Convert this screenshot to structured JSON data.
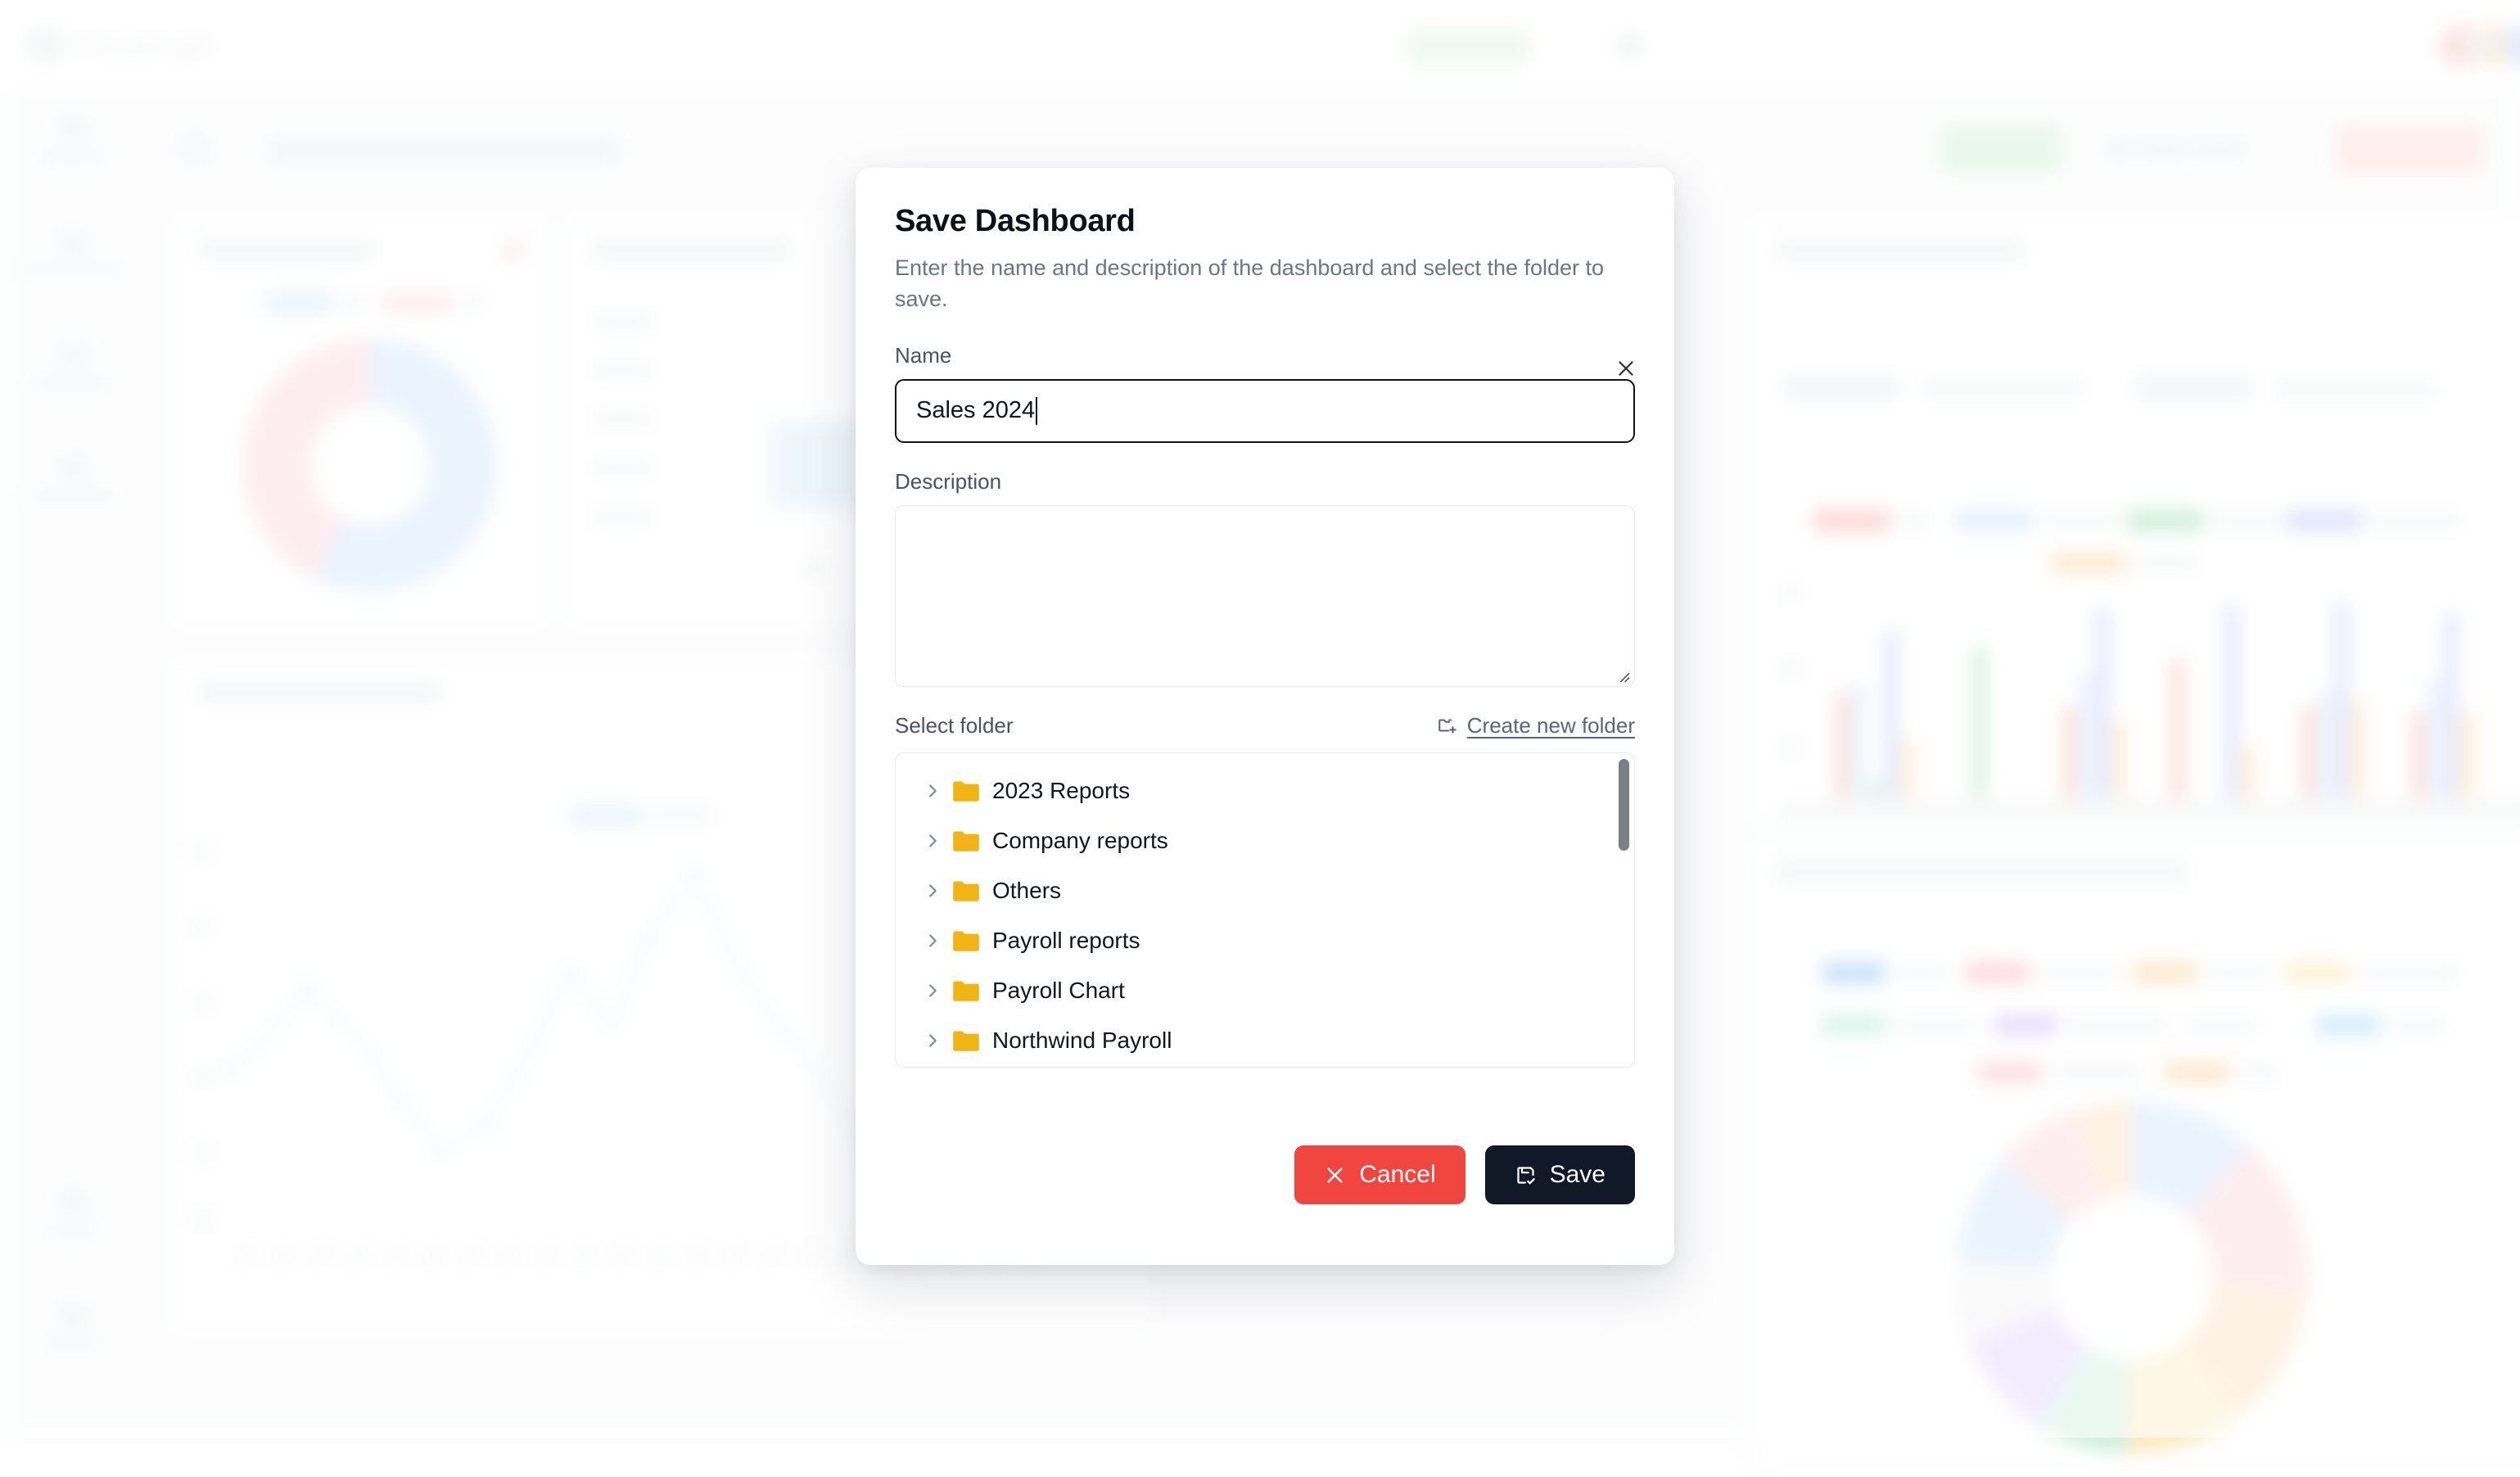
{
  "background": {
    "brand": "Flowtrail",
    "logo_icon": "grid-logo-icon",
    "topbar": {
      "upgrade_button": "",
      "avatar_colors": [
        "#f7b9b4",
        "#f8cda0",
        "#b9cdf5",
        "#f7a8bc",
        "#f6b6c6",
        "#8d9299"
      ],
      "green_button_color": "#d9efdc",
      "red_button_color": "#fcd8d6"
    },
    "sidebar_items": [
      "",
      "",
      "",
      "",
      "",
      ""
    ],
    "cards": [
      {
        "title": "Gender report",
        "type": "donut"
      },
      {
        "title": "Payroll by month",
        "type": "bar"
      },
      {
        "title": "Weekly attendance",
        "type": "grouped-bar"
      },
      {
        "title": "Shares by category",
        "type": "line"
      },
      {
        "title": "Asset Plant Cost Breakdown",
        "type": "donut"
      }
    ],
    "accent_colors": {
      "pink": "#fbd5dd",
      "blue": "#cfe4fa",
      "green": "#c7ecd0",
      "orange": "#fbdcb6",
      "purple": "#ddd8fb",
      "yellow": "#fdebc0"
    }
  },
  "modal": {
    "title": "Save Dashboard",
    "subtitle": "Enter the name and description of the dashboard and select the folder to save.",
    "close_icon": "close-icon",
    "name": {
      "label": "Name",
      "value": "Sales 2024",
      "placeholder": ""
    },
    "description": {
      "label": "Description",
      "value": "",
      "placeholder": ""
    },
    "folder_section": {
      "label": "Select folder",
      "create_link": "Create new folder",
      "create_icon": "folder-plus-icon",
      "folders": [
        {
          "name": "2023 Reports",
          "icon": "folder-icon",
          "chevron": "chevron-right-icon"
        },
        {
          "name": "Company reports",
          "icon": "folder-icon",
          "chevron": "chevron-right-icon"
        },
        {
          "name": "Others",
          "icon": "folder-icon",
          "chevron": "chevron-right-icon"
        },
        {
          "name": "Payroll reports",
          "icon": "folder-icon",
          "chevron": "chevron-right-icon"
        },
        {
          "name": "Payroll Chart",
          "icon": "folder-icon",
          "chevron": "chevron-right-icon"
        },
        {
          "name": "Northwind Payroll",
          "icon": "folder-icon",
          "chevron": "chevron-right-icon"
        }
      ],
      "folder_icon_color": "#f0b514"
    },
    "actions": {
      "cancel_label": "Cancel",
      "cancel_icon": "x-icon",
      "cancel_color": "#f0463f",
      "save_label": "Save",
      "save_icon": "save-check-icon",
      "save_color": "#111827"
    }
  }
}
